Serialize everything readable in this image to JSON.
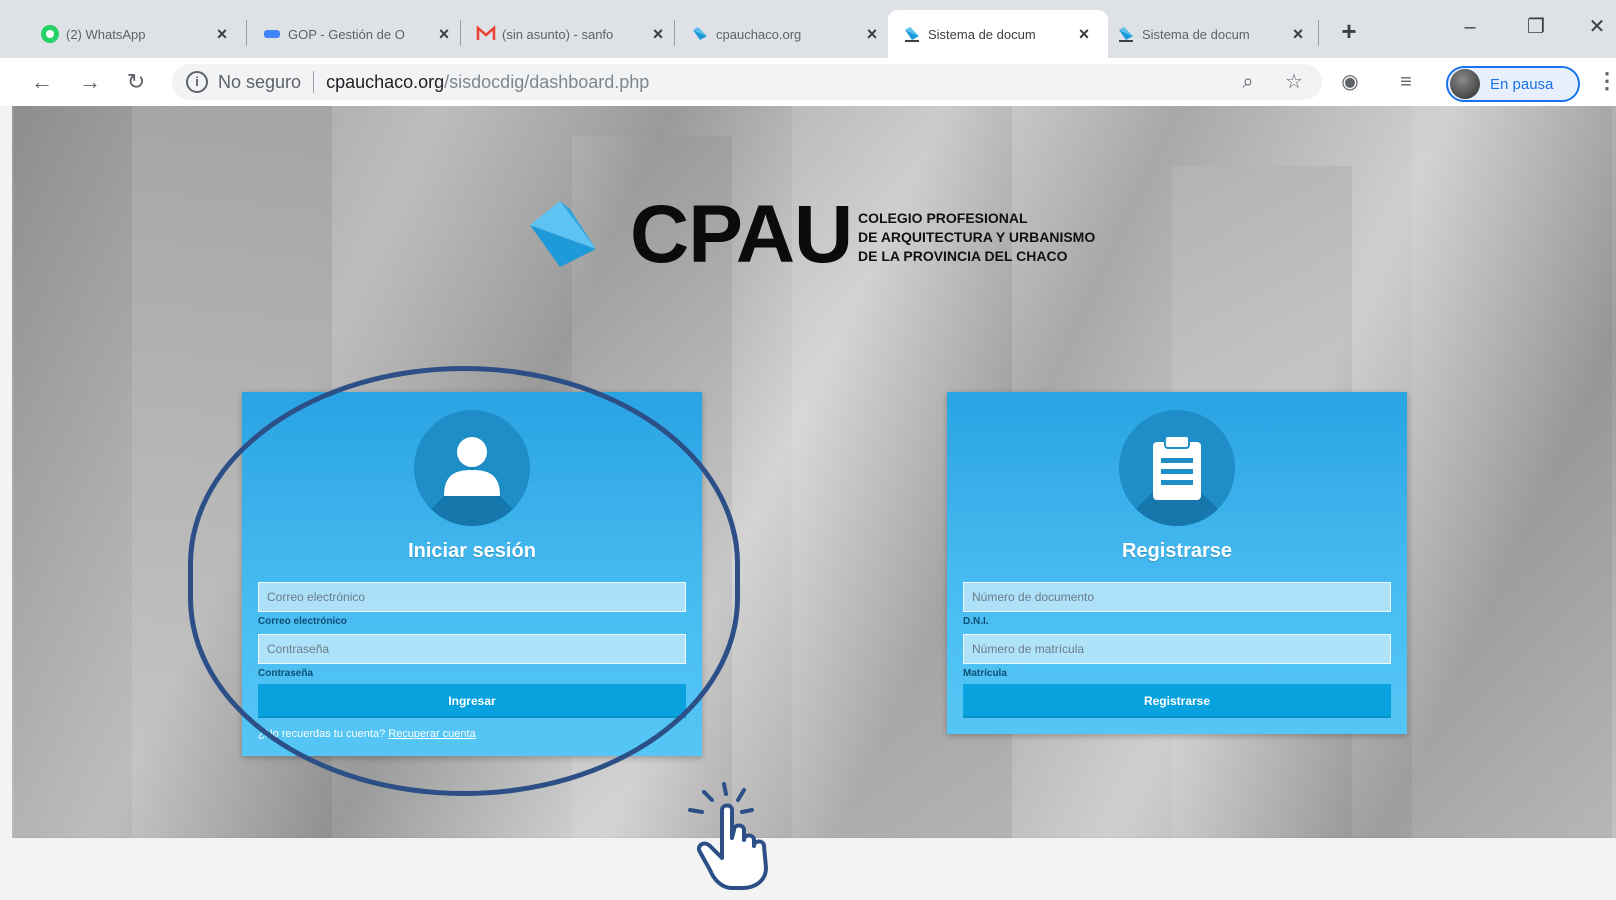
{
  "browser": {
    "tabs": [
      {
        "title": "(2) WhatsApp",
        "favicon": "whatsapp-icon",
        "active": false
      },
      {
        "title": "GOP - Gestión de O",
        "favicon": "gop-icon",
        "active": false
      },
      {
        "title": "(sin asunto) - sanfo",
        "favicon": "gmail-icon",
        "active": false
      },
      {
        "title": "cpauchaco.org",
        "favicon": "cpau-icon",
        "active": false
      },
      {
        "title": "Sistema de docum",
        "favicon": "cpau-icon",
        "active": true
      },
      {
        "title": "Sistema de docum",
        "favicon": "cpau-icon",
        "active": false
      }
    ],
    "new_tab": "+",
    "address": {
      "security_label": "No seguro",
      "host": "cpauchaco.org",
      "path": "/sisdocdig/dashboard.php"
    },
    "profile_status": "En pausa"
  },
  "logo": {
    "wordmark": "CPAU",
    "subtitle_lines": [
      "COLEGIO PROFESIONAL",
      "DE ARQUITECTURA Y URBANISMO",
      "DE LA PROVINCIA DEL CHACO"
    ]
  },
  "login": {
    "title": "Iniciar sesión",
    "email_placeholder": "Correo electrónico",
    "email_label": "Correo electrónico",
    "password_placeholder": "Contraseña",
    "password_label": "Contraseña",
    "submit_label": "Ingresar",
    "recover_prompt": "¿No recuerdas tu cuenta?",
    "recover_link": "Recuperar cuenta"
  },
  "register": {
    "title": "Registrarse",
    "document_placeholder": "Número de documento",
    "document_label": "D.N.I.",
    "matricula_placeholder": "Número de matrícula",
    "matricula_label": "Matrícula",
    "submit_label": "Registrarse"
  },
  "colors": {
    "card_blue": "#49bdf2",
    "button_blue": "#08a2df",
    "annotation_navy": "#2b4f86",
    "logo_blue": "#1e9ad8"
  }
}
